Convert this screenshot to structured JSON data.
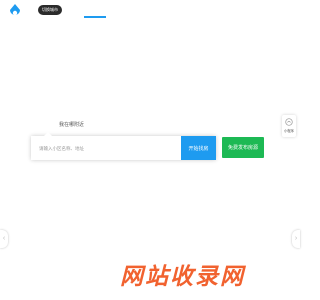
{
  "header": {
    "pill_label": "切换城市",
    "active_tab_color": "#1e9bf0"
  },
  "search": {
    "hint": "我在哪附近",
    "placeholder": "请输入小区名称、地址",
    "button_label": "开始找房",
    "button_color": "#1e9bf0"
  },
  "publish": {
    "label": "免费发布房源",
    "color": "#1db954"
  },
  "side_widget": {
    "label": "小程序",
    "icon": "miniprogram-icon"
  },
  "carousel": {
    "left_icon": "chevron-left-icon",
    "right_icon": "chevron-right-icon"
  },
  "watermark": {
    "text": "网站收录网",
    "color": "#f15a24"
  },
  "logo": {
    "icon": "brand-logo-icon",
    "color": "#1e9bf0"
  }
}
